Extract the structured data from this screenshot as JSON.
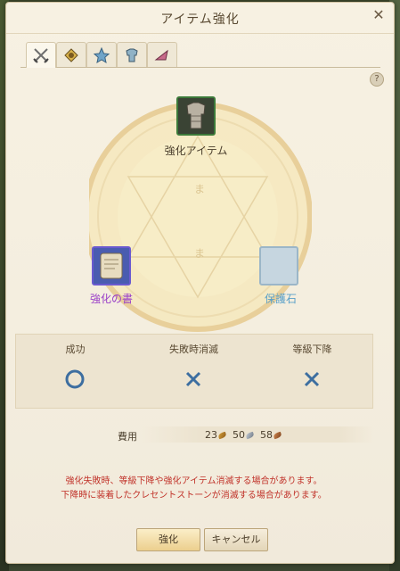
{
  "window": {
    "title": "アイテム強化",
    "close_glyph": "✕"
  },
  "tabs": [
    {
      "name": "weapon",
      "icon": "crossed-swords-icon",
      "active": true
    },
    {
      "name": "accessory",
      "icon": "pendant-icon"
    },
    {
      "name": "star",
      "icon": "star-icon"
    },
    {
      "name": "armor",
      "icon": "armor-icon"
    },
    {
      "name": "costume",
      "icon": "arrow-icon"
    }
  ],
  "help_glyph": "?",
  "slots": {
    "main_label": "強化アイテム",
    "book_label": "強化の書",
    "stone_label": "保護石"
  },
  "results": [
    {
      "label": "成功",
      "icon": "success-ring-icon"
    },
    {
      "label": "失敗時消滅",
      "icon": "cross-icon"
    },
    {
      "label": "等級下降",
      "icon": "cross-icon"
    }
  ],
  "cost": {
    "label": "費用",
    "gold": "23",
    "silver": "50",
    "copper": "58"
  },
  "warnings": [
    "強化失敗時、等級下降や強化アイテム消滅する場合があります。",
    "下降時に装着したクレセントストーンが消滅する場合があります。"
  ],
  "buttons": {
    "ok": "強化",
    "cancel": "キャンセル"
  },
  "colors": {
    "book_label": "#9a3fc8",
    "stone_label": "#5aa0c8",
    "warning": "#c1332a",
    "success_icon": "#3d6ea0",
    "cross_icon": "#3d6ea0"
  }
}
